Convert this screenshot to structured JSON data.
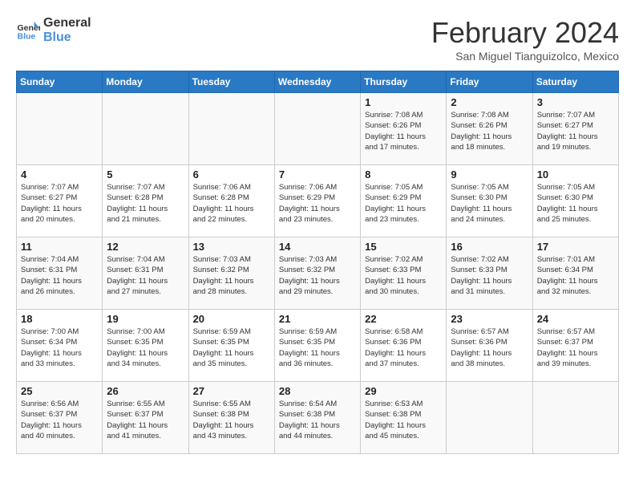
{
  "header": {
    "logo_line1": "General",
    "logo_line2": "Blue",
    "month": "February 2024",
    "location": "San Miguel Tianguizolco, Mexico"
  },
  "days_of_week": [
    "Sunday",
    "Monday",
    "Tuesday",
    "Wednesday",
    "Thursday",
    "Friday",
    "Saturday"
  ],
  "weeks": [
    [
      {
        "day": "",
        "info": ""
      },
      {
        "day": "",
        "info": ""
      },
      {
        "day": "",
        "info": ""
      },
      {
        "day": "",
        "info": ""
      },
      {
        "day": "1",
        "info": "Sunrise: 7:08 AM\nSunset: 6:26 PM\nDaylight: 11 hours\nand 17 minutes."
      },
      {
        "day": "2",
        "info": "Sunrise: 7:08 AM\nSunset: 6:26 PM\nDaylight: 11 hours\nand 18 minutes."
      },
      {
        "day": "3",
        "info": "Sunrise: 7:07 AM\nSunset: 6:27 PM\nDaylight: 11 hours\nand 19 minutes."
      }
    ],
    [
      {
        "day": "4",
        "info": "Sunrise: 7:07 AM\nSunset: 6:27 PM\nDaylight: 11 hours\nand 20 minutes."
      },
      {
        "day": "5",
        "info": "Sunrise: 7:07 AM\nSunset: 6:28 PM\nDaylight: 11 hours\nand 21 minutes."
      },
      {
        "day": "6",
        "info": "Sunrise: 7:06 AM\nSunset: 6:28 PM\nDaylight: 11 hours\nand 22 minutes."
      },
      {
        "day": "7",
        "info": "Sunrise: 7:06 AM\nSunset: 6:29 PM\nDaylight: 11 hours\nand 23 minutes."
      },
      {
        "day": "8",
        "info": "Sunrise: 7:05 AM\nSunset: 6:29 PM\nDaylight: 11 hours\nand 23 minutes."
      },
      {
        "day": "9",
        "info": "Sunrise: 7:05 AM\nSunset: 6:30 PM\nDaylight: 11 hours\nand 24 minutes."
      },
      {
        "day": "10",
        "info": "Sunrise: 7:05 AM\nSunset: 6:30 PM\nDaylight: 11 hours\nand 25 minutes."
      }
    ],
    [
      {
        "day": "11",
        "info": "Sunrise: 7:04 AM\nSunset: 6:31 PM\nDaylight: 11 hours\nand 26 minutes."
      },
      {
        "day": "12",
        "info": "Sunrise: 7:04 AM\nSunset: 6:31 PM\nDaylight: 11 hours\nand 27 minutes."
      },
      {
        "day": "13",
        "info": "Sunrise: 7:03 AM\nSunset: 6:32 PM\nDaylight: 11 hours\nand 28 minutes."
      },
      {
        "day": "14",
        "info": "Sunrise: 7:03 AM\nSunset: 6:32 PM\nDaylight: 11 hours\nand 29 minutes."
      },
      {
        "day": "15",
        "info": "Sunrise: 7:02 AM\nSunset: 6:33 PM\nDaylight: 11 hours\nand 30 minutes."
      },
      {
        "day": "16",
        "info": "Sunrise: 7:02 AM\nSunset: 6:33 PM\nDaylight: 11 hours\nand 31 minutes."
      },
      {
        "day": "17",
        "info": "Sunrise: 7:01 AM\nSunset: 6:34 PM\nDaylight: 11 hours\nand 32 minutes."
      }
    ],
    [
      {
        "day": "18",
        "info": "Sunrise: 7:00 AM\nSunset: 6:34 PM\nDaylight: 11 hours\nand 33 minutes."
      },
      {
        "day": "19",
        "info": "Sunrise: 7:00 AM\nSunset: 6:35 PM\nDaylight: 11 hours\nand 34 minutes."
      },
      {
        "day": "20",
        "info": "Sunrise: 6:59 AM\nSunset: 6:35 PM\nDaylight: 11 hours\nand 35 minutes."
      },
      {
        "day": "21",
        "info": "Sunrise: 6:59 AM\nSunset: 6:35 PM\nDaylight: 11 hours\nand 36 minutes."
      },
      {
        "day": "22",
        "info": "Sunrise: 6:58 AM\nSunset: 6:36 PM\nDaylight: 11 hours\nand 37 minutes."
      },
      {
        "day": "23",
        "info": "Sunrise: 6:57 AM\nSunset: 6:36 PM\nDaylight: 11 hours\nand 38 minutes."
      },
      {
        "day": "24",
        "info": "Sunrise: 6:57 AM\nSunset: 6:37 PM\nDaylight: 11 hours\nand 39 minutes."
      }
    ],
    [
      {
        "day": "25",
        "info": "Sunrise: 6:56 AM\nSunset: 6:37 PM\nDaylight: 11 hours\nand 40 minutes."
      },
      {
        "day": "26",
        "info": "Sunrise: 6:55 AM\nSunset: 6:37 PM\nDaylight: 11 hours\nand 41 minutes."
      },
      {
        "day": "27",
        "info": "Sunrise: 6:55 AM\nSunset: 6:38 PM\nDaylight: 11 hours\nand 43 minutes."
      },
      {
        "day": "28",
        "info": "Sunrise: 6:54 AM\nSunset: 6:38 PM\nDaylight: 11 hours\nand 44 minutes."
      },
      {
        "day": "29",
        "info": "Sunrise: 6:53 AM\nSunset: 6:38 PM\nDaylight: 11 hours\nand 45 minutes."
      },
      {
        "day": "",
        "info": ""
      },
      {
        "day": "",
        "info": ""
      }
    ]
  ]
}
